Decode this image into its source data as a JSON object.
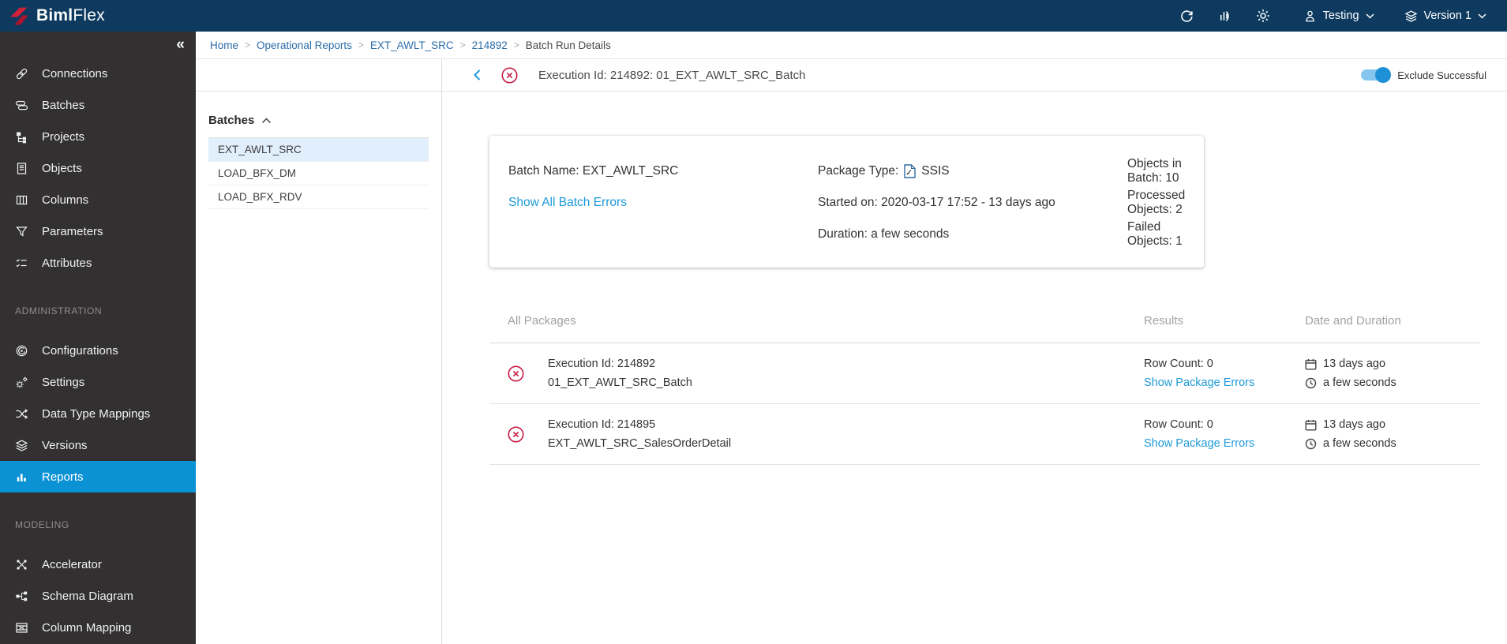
{
  "brand": {
    "logo_bold": "Biml",
    "logo_light": "Flex"
  },
  "topbar": {
    "user_label": "Testing",
    "version_label": "Version 1"
  },
  "breadcrumb": {
    "items": [
      "Home",
      "Operational Reports",
      "EXT_AWLT_SRC",
      "214892"
    ],
    "current": "Batch Run Details",
    "separator": ">"
  },
  "sidebar": {
    "collapse_glyph": "«",
    "sections": [
      {
        "items": [
          {
            "label": "Connections",
            "icon": "link-icon"
          },
          {
            "label": "Batches",
            "icon": "batches-icon"
          },
          {
            "label": "Projects",
            "icon": "projects-icon"
          },
          {
            "label": "Objects",
            "icon": "objects-icon"
          },
          {
            "label": "Columns",
            "icon": "columns-icon"
          },
          {
            "label": "Parameters",
            "icon": "filter-icon"
          },
          {
            "label": "Attributes",
            "icon": "attributes-icon"
          }
        ]
      },
      {
        "header": "ADMINISTRATION",
        "items": [
          {
            "label": "Configurations",
            "icon": "configurations-icon"
          },
          {
            "label": "Settings",
            "icon": "gears-icon"
          },
          {
            "label": "Data Type Mappings",
            "icon": "shuffle-icon"
          },
          {
            "label": "Versions",
            "icon": "layers-icon"
          },
          {
            "label": "Reports",
            "icon": "bar-chart-icon",
            "active": true
          }
        ]
      },
      {
        "header": "MODELING",
        "items": [
          {
            "label": "Accelerator",
            "icon": "network-icon"
          },
          {
            "label": "Schema Diagram",
            "icon": "schema-icon"
          },
          {
            "label": "Column Mapping",
            "icon": "column-mapping-icon"
          }
        ]
      }
    ]
  },
  "batches_panel": {
    "title": "Batches",
    "items": [
      {
        "label": "EXT_AWLT_SRC",
        "selected": true
      },
      {
        "label": "LOAD_BFX_DM",
        "selected": false
      },
      {
        "label": "LOAD_BFX_RDV",
        "selected": false
      }
    ]
  },
  "detail_header": {
    "title": "Execution Id: 214892: 01_EXT_AWLT_SRC_Batch",
    "toggle_label": "Exclude Successful",
    "toggle_on": true
  },
  "summary_card": {
    "batch_name": "Batch Name: EXT_AWLT_SRC",
    "errors_link": "Show All Batch Errors",
    "package_type_label": "Package Type:",
    "package_type_value": "SSIS",
    "started": "Started on: 2020-03-17 17:52 - 13 days ago",
    "duration": "Duration: a few seconds",
    "objects_in_batch": "Objects in Batch: 10",
    "processed_objects": "Processed Objects: 2",
    "failed_objects": "Failed Objects: 1"
  },
  "packages_table": {
    "headers": [
      "All Packages",
      "Results",
      "Date and Duration"
    ],
    "rows": [
      {
        "execution_id": "Execution Id: 214892",
        "package_name": "01_EXT_AWLT_SRC_Batch",
        "row_count": "Row Count: 0",
        "errors_link": "Show Package Errors",
        "date": "13 days ago",
        "duration": "a few seconds"
      },
      {
        "execution_id": "Execution Id: 214895",
        "package_name": "EXT_AWLT_SRC_SalesOrderDetail",
        "row_count": "Row Count: 0",
        "errors_link": "Show Package Errors",
        "date": "13 days ago",
        "duration": "a few seconds"
      }
    ]
  },
  "colors": {
    "topbar_navy": "#0d3a5e",
    "sidebar_bg": "#323031",
    "active_item_blue": "#0a92d5",
    "link_blue": "#1e9ad8",
    "breadcrumb_blue": "#2b6ca8",
    "error_red": "#c41d45",
    "selected_row_blue": "#e1eefb",
    "toggle_track": "#85c6ee",
    "toggle_knob": "#1e90d6"
  }
}
